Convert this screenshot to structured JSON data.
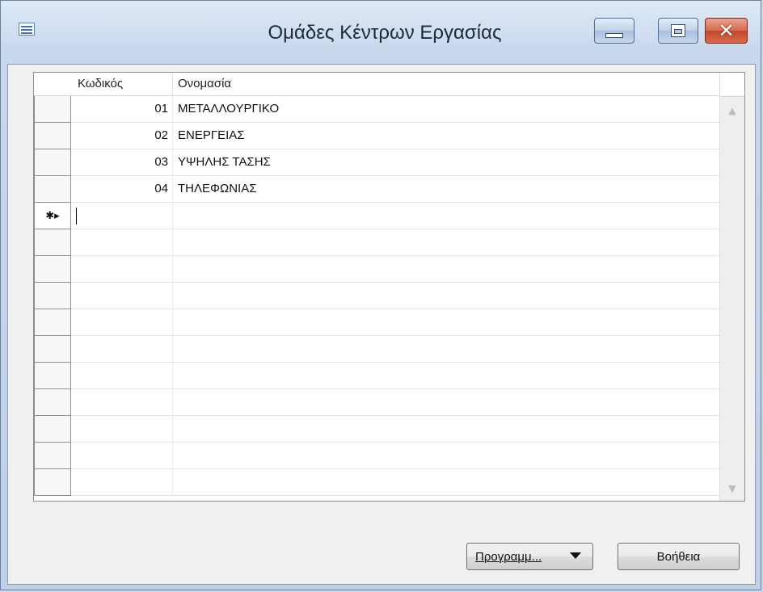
{
  "window": {
    "title": "Ομάδες Κέντρων Εργασίας",
    "controls": {
      "minimize": "minimize",
      "maximize": "maximize",
      "close": "✕"
    }
  },
  "grid": {
    "columns": {
      "code": "Κωδικός",
      "name": "Ονομασία"
    },
    "rows": [
      {
        "code": "01",
        "name": "ΜΕΤΑΛΛΟΥΡΓΙΚΟ"
      },
      {
        "code": "02",
        "name": "ΕΝΕΡΓΕΙΑΣ"
      },
      {
        "code": "03",
        "name": "ΥΨΗΛΗΣ ΤΑΣΗΣ"
      },
      {
        "code": "04",
        "name": "ΤΗΛΕΦΩΝΙΑΣ"
      }
    ],
    "new_row_marker": "✱▸",
    "scroll_up": "▲",
    "scroll_down": "▼"
  },
  "buttons": {
    "programs": "Προγραμμ...",
    "help": "Βοήθεια"
  },
  "icons": {
    "window_icon": "form-icon",
    "scroll_up": "chevron-up-icon",
    "scroll_down": "chevron-down-icon",
    "dropdown": "caret-down-icon"
  }
}
